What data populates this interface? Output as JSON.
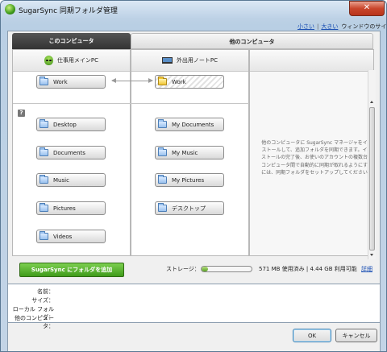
{
  "window": {
    "title": "SugarSync 同期フォルダ管理",
    "close_symbol": "✕"
  },
  "size_links": {
    "small": "小さい",
    "separator": "|",
    "large": "大きい",
    "window_size": "ウィンドウのサイズ"
  },
  "headers": {
    "this_computer": "このコンピュータ",
    "other_computer": "他のコンピュータ"
  },
  "computers": {
    "main_pc": "仕事用メインPC",
    "notebook_pc": "外出用ノートPC"
  },
  "synced_pair": {
    "left": "Work",
    "right": "Work"
  },
  "help_symbol": "?",
  "left_folders": [
    "Desktop",
    "Documents",
    "Music",
    "Pictures",
    "Videos"
  ],
  "right_folders": [
    "My Documents",
    "My Music",
    "My Pictures",
    "デスクトップ"
  ],
  "info_text": "他のコンピュータに SugarSync マネージャをインストールして、追加フォルダを同期できます。インストールの完了後、お使いのアカウントの複数台のコンピュータ間で自動的に同期が取れるようにするには、同期フォルダをセットアップしてください。",
  "add_button": "SugarSync にフォルダを追加",
  "storage": {
    "label": "ストレージ：",
    "usage_text": "571 MB 使用済み | 4.44 GB 利用可能",
    "used_fraction": 0.13,
    "detail_link": "詳細"
  },
  "details": {
    "name": "名前：",
    "size": "サイズ：",
    "local_folder": "ローカル フォルダ：",
    "other_computer": "他のコンピュータ："
  },
  "buttons": {
    "ok": "OK",
    "cancel": "キャンセル"
  },
  "colors": {
    "accent_green": "#3f9b1a",
    "link_blue": "#1a4fb3",
    "header_dark": "#333333"
  }
}
